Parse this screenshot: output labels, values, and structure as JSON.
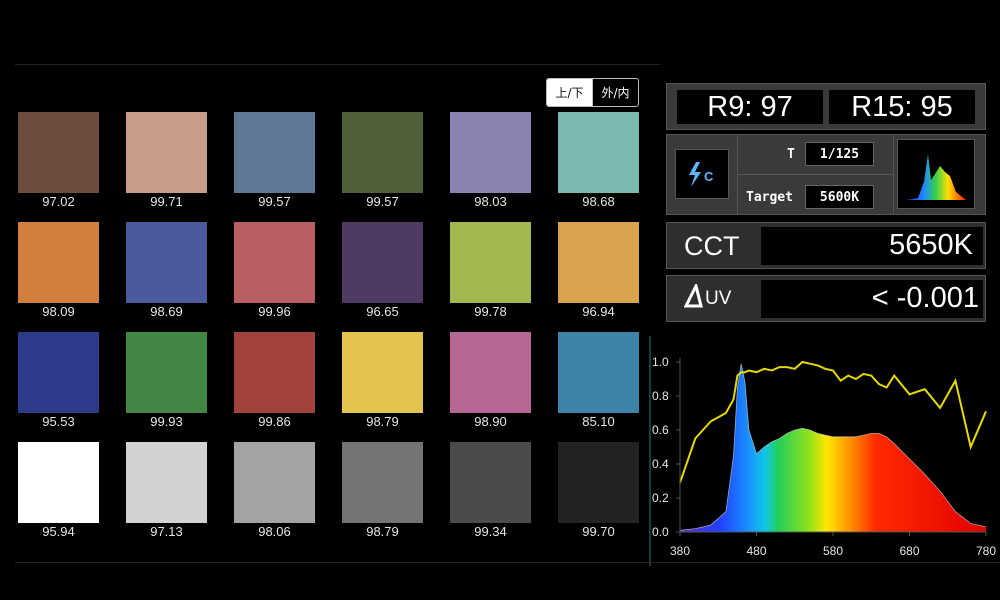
{
  "toggle": {
    "left_label": "上/下",
    "right_label": "外/内",
    "active": "left"
  },
  "swatches": [
    {
      "color": "#6b4c3f",
      "value": "97.02"
    },
    {
      "color": "#c89c8b",
      "value": "99.71"
    },
    {
      "color": "#5e7896",
      "value": "99.57"
    },
    {
      "color": "#4f6039",
      "value": "99.57"
    },
    {
      "color": "#8a83b2",
      "value": "98.03"
    },
    {
      "color": "#7cb8b0",
      "value": "98.68"
    },
    {
      "color": "#d07f3e",
      "value": "98.09"
    },
    {
      "color": "#4a5a9c",
      "value": "98.69"
    },
    {
      "color": "#b95f63",
      "value": "99.96"
    },
    {
      "color": "#4f3a62",
      "value": "96.65"
    },
    {
      "color": "#a0b84e",
      "value": "99.78"
    },
    {
      "color": "#d9a24c",
      "value": "96.94"
    },
    {
      "color": "#2e3b8a",
      "value": "95.53"
    },
    {
      "color": "#448745",
      "value": "99.93"
    },
    {
      "color": "#a2423c",
      "value": "99.86"
    },
    {
      "color": "#e2c44f",
      "value": "98.79"
    },
    {
      "color": "#b76793",
      "value": "98.90"
    },
    {
      "color": "#3e84a8",
      "value": "85.10"
    },
    {
      "color": "#ffffff",
      "value": "95.94"
    },
    {
      "color": "#d2d2d2",
      "value": "97.13"
    },
    {
      "color": "#a3a3a3",
      "value": "98.06"
    },
    {
      "color": "#747474",
      "value": "98.79"
    },
    {
      "color": "#4b4b4b",
      "value": "99.34"
    },
    {
      "color": "#232323",
      "value": "99.70"
    }
  ],
  "r_values": {
    "r9": "R9: 97",
    "r15": "R15: 95"
  },
  "mode_icon": "flash-c-icon",
  "shutter": {
    "label": "T",
    "value": "1/125"
  },
  "target": {
    "label": "Target",
    "value": "5600K"
  },
  "spectrum_thumb_icon": "spectrum-thumbnail-icon",
  "cct": {
    "label": "CCT",
    "value": "5650K"
  },
  "duv": {
    "label": "UV",
    "value": "< -0.001"
  },
  "chart_data": {
    "type": "area",
    "x": [
      380,
      400,
      420,
      440,
      450,
      455,
      460,
      465,
      470,
      480,
      490,
      500,
      510,
      520,
      530,
      540,
      550,
      560,
      570,
      580,
      590,
      600,
      610,
      620,
      630,
      640,
      650,
      660,
      680,
      700,
      720,
      740,
      760,
      780
    ],
    "series": [
      {
        "values": [
          0.01,
          0.02,
          0.04,
          0.12,
          0.45,
          0.85,
          0.99,
          0.88,
          0.6,
          0.46,
          0.5,
          0.53,
          0.55,
          0.58,
          0.6,
          0.61,
          0.6,
          0.58,
          0.57,
          0.56,
          0.56,
          0.56,
          0.56,
          0.57,
          0.58,
          0.58,
          0.56,
          0.52,
          0.43,
          0.34,
          0.24,
          0.12,
          0.05,
          0.03
        ]
      },
      {
        "values": [
          0.29,
          0.55,
          0.65,
          0.7,
          0.78,
          0.92,
          0.94,
          0.94,
          0.95,
          0.94,
          0.96,
          0.95,
          0.97,
          0.97,
          0.96,
          1.0,
          0.99,
          0.98,
          0.96,
          0.95,
          0.89,
          0.92,
          0.9,
          0.93,
          0.92,
          0.87,
          0.85,
          0.92,
          0.81,
          0.84,
          0.73,
          0.89,
          0.5,
          0.71
        ]
      }
    ],
    "xlim": [
      380,
      780
    ],
    "ylim": [
      0,
      1.0
    ],
    "xticks": [
      "380",
      "480",
      "580",
      "680",
      "780"
    ],
    "yticks": [
      "0.0",
      "0.2",
      "0.4",
      "0.6",
      "0.8",
      "1.0"
    ],
    "colors": {
      "line": "#e6d800",
      "axis": "#555555"
    }
  }
}
